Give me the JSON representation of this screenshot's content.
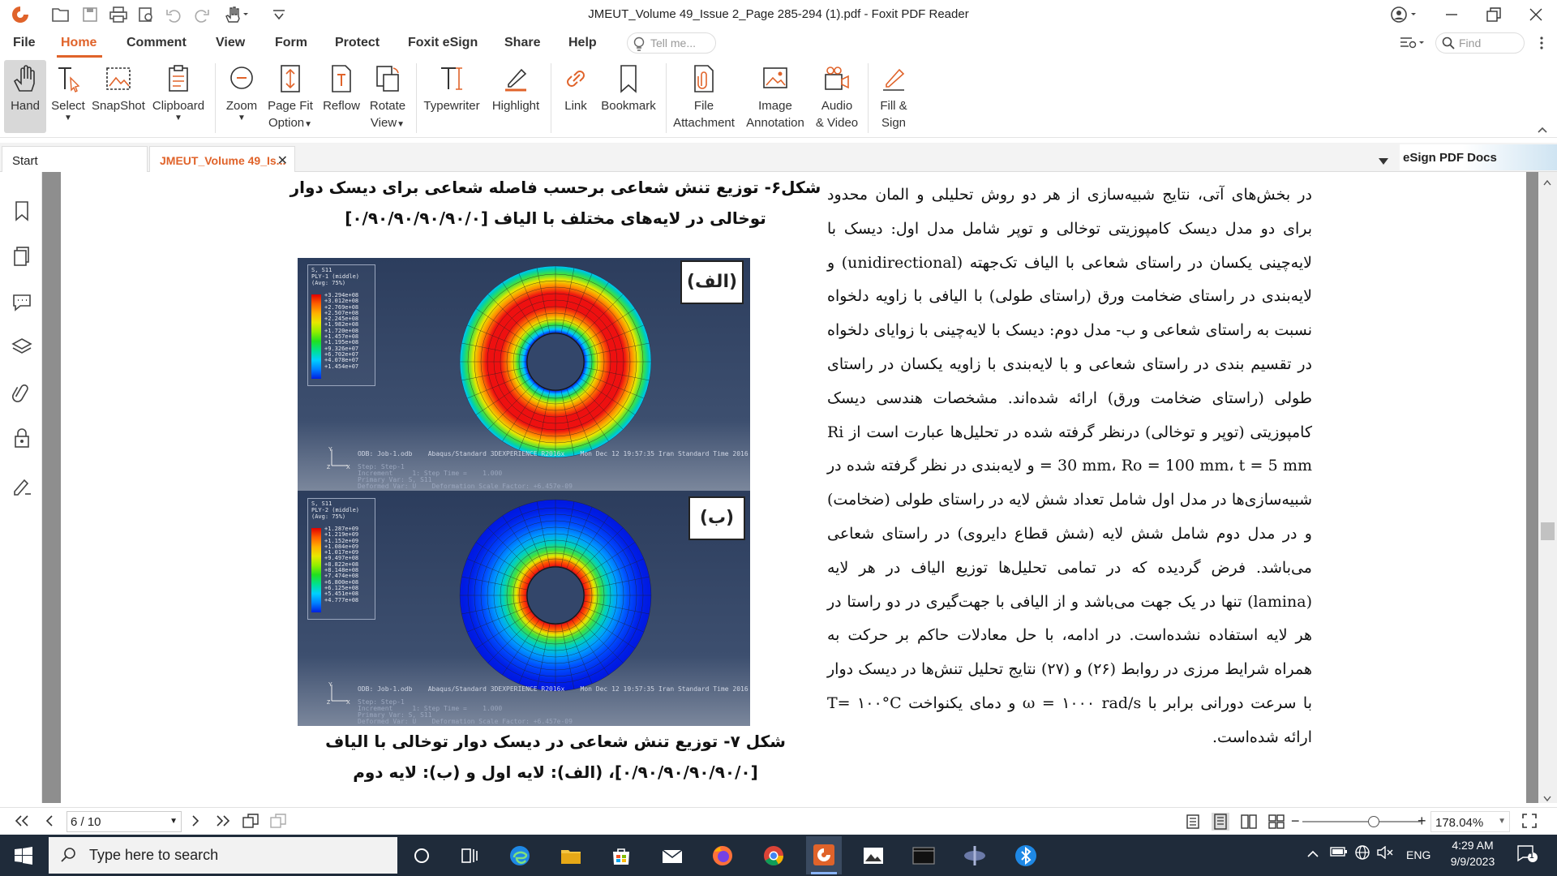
{
  "app": {
    "title": "JMEUT_Volume 49_Issue 2_Page 285-294 (1).pdf - Foxit PDF Reader",
    "accent": "#e0632a"
  },
  "menu": {
    "items": [
      "File",
      "Home",
      "Comment",
      "View",
      "Form",
      "Protect",
      "Foxit eSign",
      "Share",
      "Help"
    ],
    "active": "Home",
    "tell_me_placeholder": "Tell me...",
    "find_placeholder": "Find"
  },
  "ribbon": {
    "tools": [
      {
        "label": "Hand",
        "icon": "hand-icon",
        "selected": true
      },
      {
        "label": "Select",
        "icon": "select-text-icon",
        "caret": true
      },
      {
        "label": "SnapShot",
        "icon": "snapshot-icon"
      },
      {
        "label": "Clipboard",
        "icon": "clipboard-icon",
        "caret": true
      },
      {
        "label": "Zoom",
        "icon": "zoom-icon",
        "caret": true
      },
      {
        "label": "Page Fit Option",
        "line1": "Page Fit",
        "line2": "Option",
        "icon": "page-fit-icon",
        "caret": true
      },
      {
        "label": "Reflow",
        "icon": "reflow-icon"
      },
      {
        "label": "Rotate View",
        "line1": "Rotate",
        "line2": "View",
        "icon": "rotate-view-icon",
        "caret": true
      },
      {
        "label": "Typewriter",
        "icon": "typewriter-icon"
      },
      {
        "label": "Highlight",
        "icon": "highlight-icon"
      },
      {
        "label": "Link",
        "icon": "link-icon"
      },
      {
        "label": "Bookmark",
        "icon": "bookmark-icon"
      },
      {
        "label": "File Attachment",
        "line1": "File",
        "line2": "Attachment",
        "icon": "file-attachment-icon"
      },
      {
        "label": "Image Annotation",
        "line1": "Image",
        "line2": "Annotation",
        "icon": "image-annotation-icon"
      },
      {
        "label": "Audio & Video",
        "line1": "Audio",
        "line2": "& Video",
        "icon": "audio-video-icon"
      },
      {
        "label": "Fill & Sign",
        "line1": "Fill &",
        "line2": "Sign",
        "icon": "fill-sign-icon"
      }
    ]
  },
  "tabs": {
    "start": "Start",
    "document": "JMEUT_Volume 49_Is...",
    "esign_docs": "eSign PDF Docs"
  },
  "document": {
    "caption6_line1": "شکل۶- توزیع تنش شعاعی برحسب فاصله شعاعی برای دیسک دوار",
    "caption6_line2": "توخالی در لایه‌های مختلف با الیاف [۰/۹۰/۹۰/۹۰/۹۰/۰]",
    "caption7_line1": "شکل ۷- توزیع تنش شعاعی در دیسک دوار توخالی با الیاف",
    "caption7_line2": "[۰/۹۰/۹۰/۹۰/۹۰/۰]، (الف): لایه اول و (ب): لایه دوم",
    "fig_label_a": "(الف)",
    "fig_label_b": "(ب)",
    "body_text": "در بخش‌های آتی، نتایج شبیه‌سازی از هر دو روش تحلیلی و المان محدود برای دو مدل دیسک کامپوزیتی توخالی و توپر شامل مدل اول: دیسک با لایه‌چینی یکسان در راستای شعاعی با الیاف تک‌جهته (unidirectional) و لایه‌بندی در راستای ضخامت ورق (راستای طولی) با الیافی با زاویه دلخواه نسبت به راستای شعاعی و ب- مدل دوم: دیسک با لایه‌چینی با زوایای دلخواه در تقسیم بندی در راستای شعاعی و با لایه‌بندی با زاویه یکسان در راستای طولی (راستای ضخامت ورق) ارائه شده‌اند. مشخصات هندسی دیسک کامپوزیتی (توپر و توخالی) درنظر گرفته شده در تحلیل‌ها عبارت است از Ri = 30 mm، Ro = 100 mm، t = 5 mm و لایه‌بندی در نظر گرفته شده در شبیه‌سازی‌ها در مدل اول شامل تعداد شش لایه در راستای طولی (ضخامت) و در مدل دوم شامل شش لایه (شش قطاع دایروی) در راستای شعاعی می‌باشد. فرض گردیده که در تمامی تحلیل‌ها توزیع الیاف در هر لایه (lamina) تنها در یک جهت می‌باشد و از الیافی با جهت‌گیری در دو راستا در هر لایه استفاده نشده‌است. در ادامه، با حل معادلات حاکم بر حرکت به همراه شرایط مرزی در روابط (۲۶) و (۲۷) نتایج تحلیل تنش‌ها در دیسک دوار با سرعت دورانی برابر با ω = ۱۰۰۰ rad/s و دمای یکنواخت T= ۱۰۰°C ارائه شده‌است.",
    "legend_a": {
      "title1": "S, S11",
      "title2": "PLY-1 (middle)",
      "title3": "(Avg: 75%)",
      "values": [
        "+3.294e+08",
        "+3.012e+08",
        "+2.769e+08",
        "+2.507e+08",
        "+2.245e+08",
        "+1.982e+08",
        "+1.720e+08",
        "+1.457e+08",
        "+1.195e+08",
        "+9.326e+07",
        "+6.702e+07",
        "+4.078e+07",
        "+1.454e+07"
      ]
    },
    "legend_b": {
      "title1": "S, S11",
      "title2": "PLY-2 (middle)",
      "title3": "(Avg: 75%)",
      "values": [
        "+1.287e+09",
        "+1.219e+09",
        "+1.152e+09",
        "+1.084e+09",
        "+1.017e+09",
        "+9.497e+08",
        "+8.822e+08",
        "+8.148e+08",
        "+7.474e+08",
        "+6.800e+08",
        "+6.125e+08",
        "+5.451e+08",
        "+4.777e+08"
      ]
    },
    "odb_a": "ODB: Job-1.odb    Abaqus/Standard 3DEXPERIENCE R2016x    Mon Dec 12 19:57:35 Iran Standard Time 2016",
    "odb_b": "ODB: Job-1.odb    Abaqus/Standard 3DEXPERIENCE R2016x    Mon Dec 12 19:57:35 Iran Standard Time 2016",
    "step_info": "Step: Step-1\nIncrement     1: Step Time =    1.000\nPrimary Var: S, S11\nDeformed Var: U    Deformation Scale Factor: +6.457e-09"
  },
  "status": {
    "page": "6 / 10",
    "zoom": "178.04%"
  },
  "taskbar": {
    "search_placeholder": "Type here to search",
    "lang": "ENG",
    "time": "4:29 AM",
    "date": "9/9/2023",
    "notif_count": "1"
  }
}
